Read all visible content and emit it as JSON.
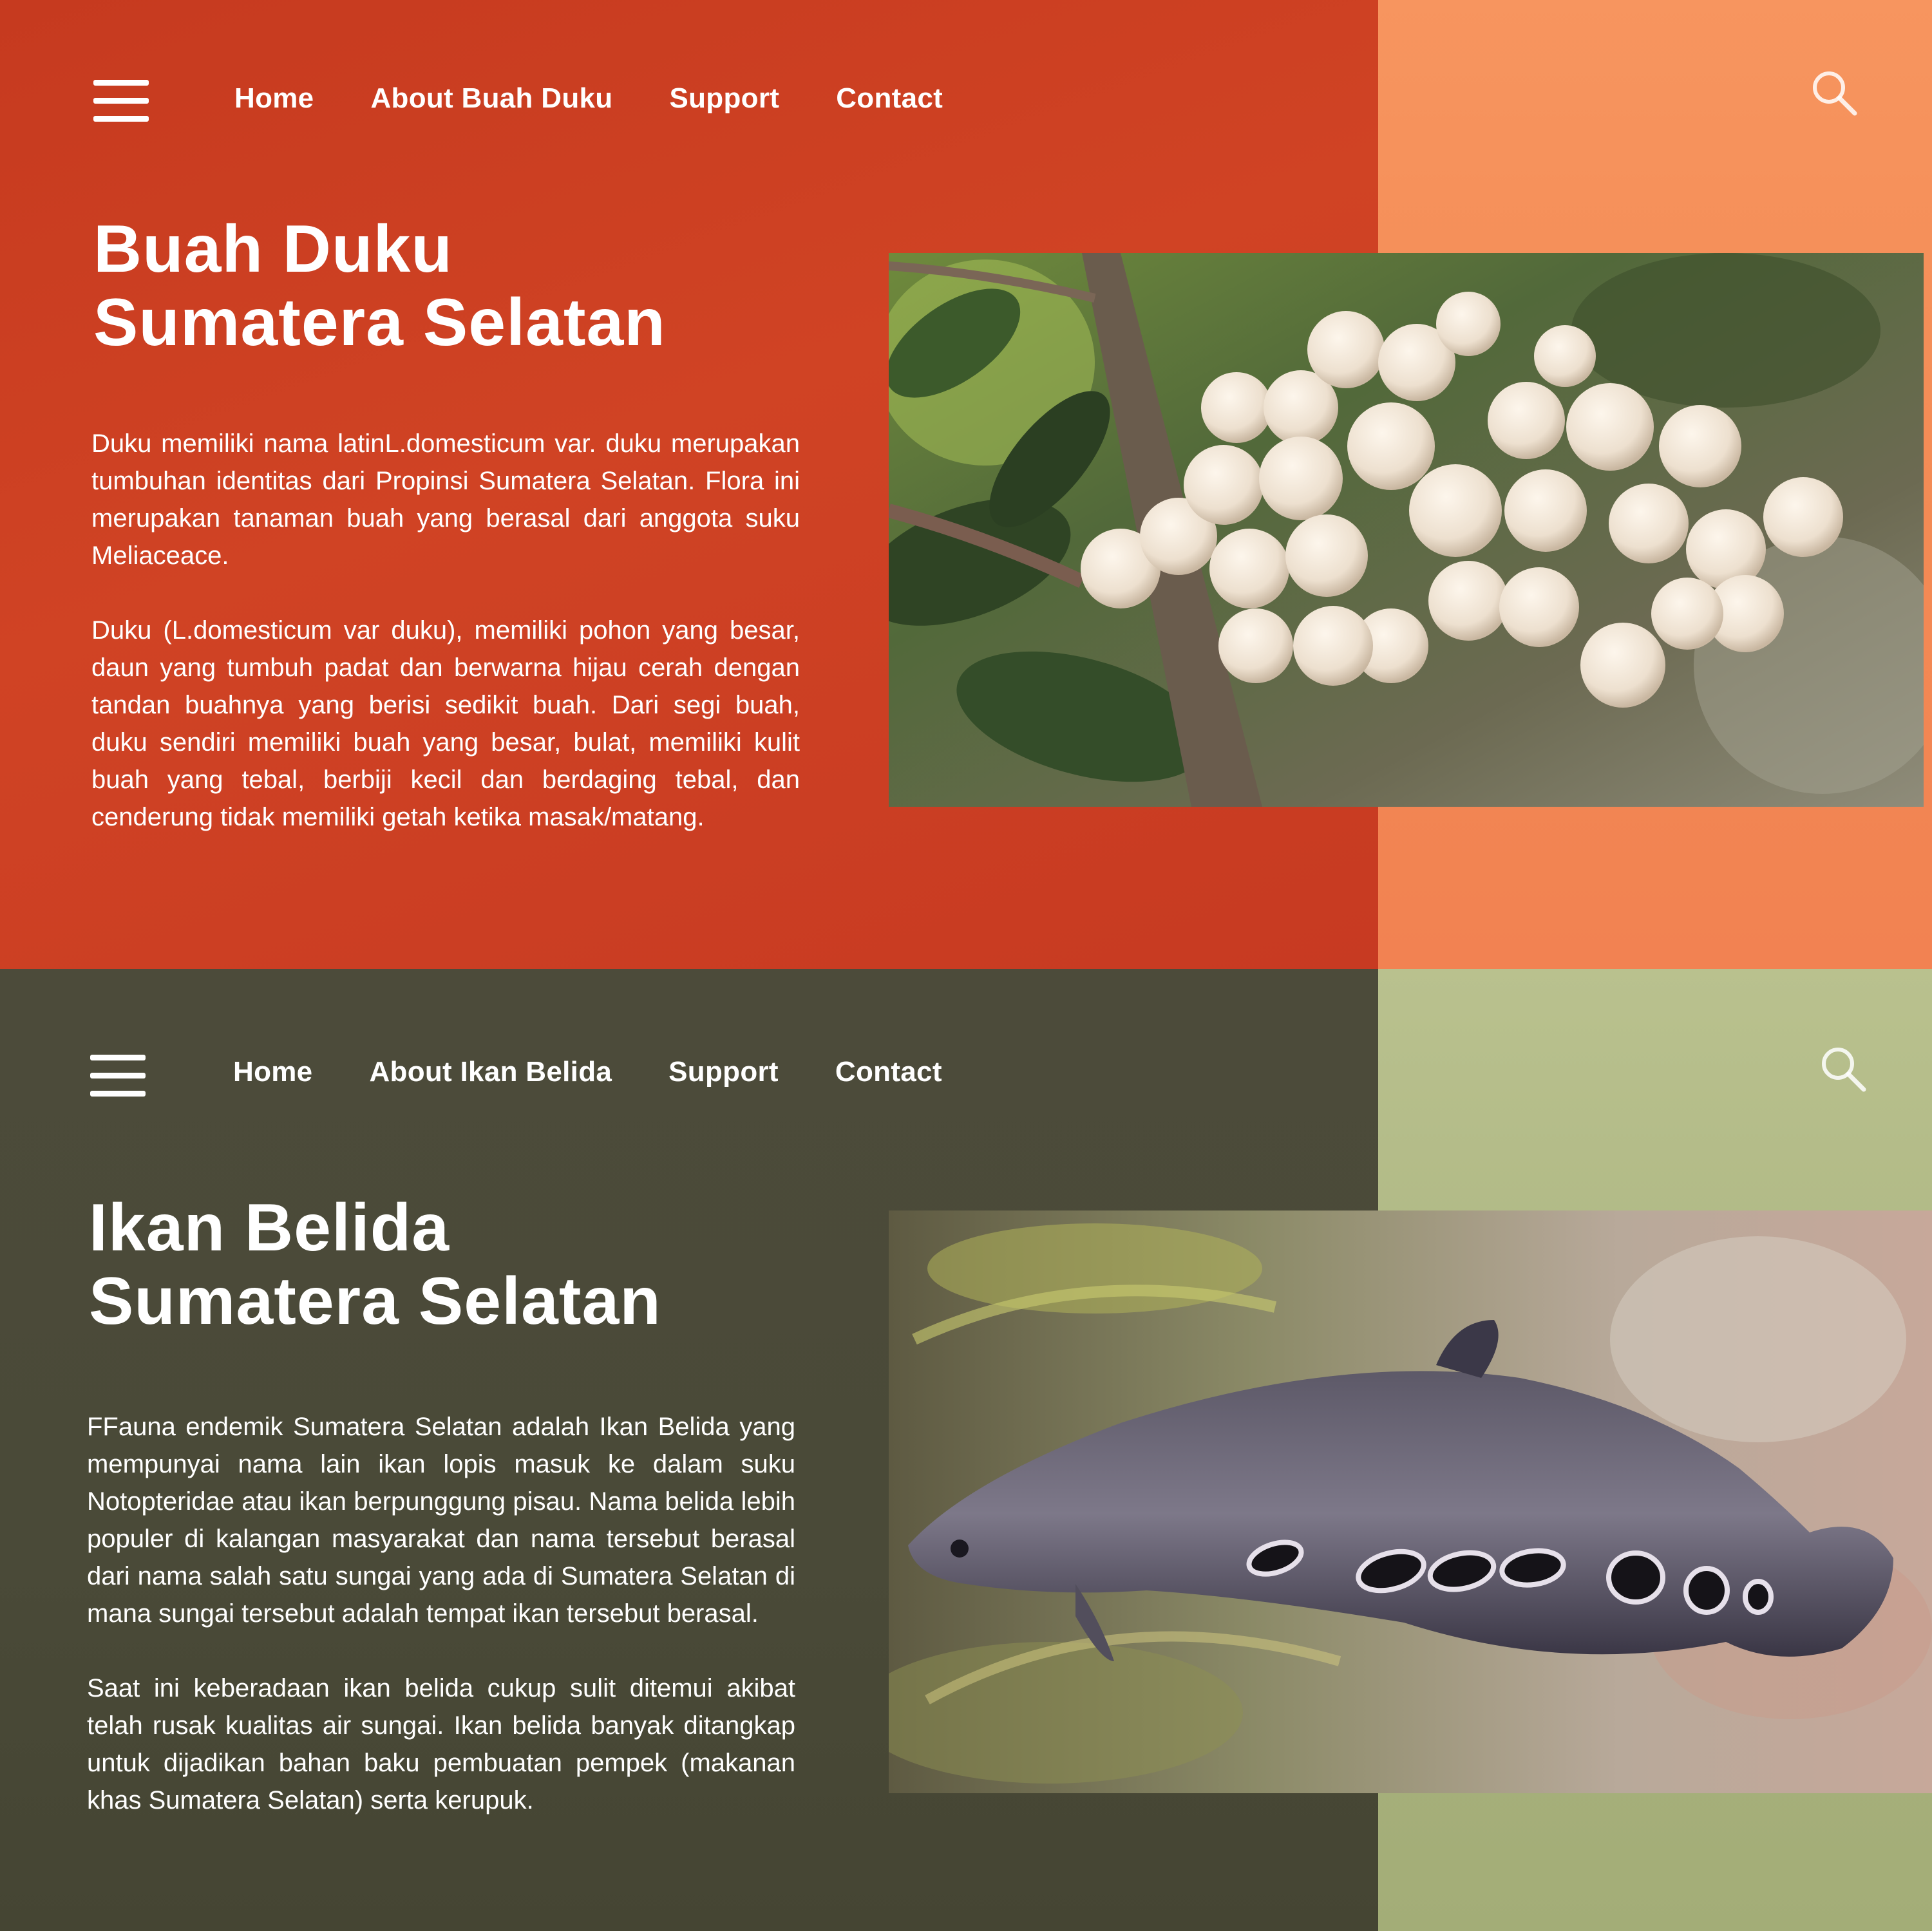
{
  "duku": {
    "nav": [
      "Home",
      "About Buah Duku",
      "Support",
      "Contact"
    ],
    "title_line1": "Buah Duku",
    "title_line2": "Sumatera Selatan",
    "paragraphs": [
      "Duku memiliki nama latinL.domesticum var. duku merupakan tumbuhan identitas dari Propinsi Sumatera Selatan. Flora ini merupakan tanaman buah yang berasal dari anggota suku Meliaceace.",
      "Duku (L.domesticum var  duku), memiliki pohon yang besar, daun yang tumbuh padat dan berwarna hijau cerah dengan tandan buahnya yang berisi sedikit buah. Dari segi buah, duku sendiri memiliki buah yang besar, bulat, memiliki kulit buah yang tebal, berbiji kecil dan berdaging tebal, dan cenderung tidak memiliki getah ketika masak/matang."
    ],
    "colors": {
      "left": "#c83c21",
      "right": "#f38a54"
    }
  },
  "belida": {
    "nav": [
      "Home",
      "About Ikan Belida",
      "Support",
      "Contact"
    ],
    "title_line1": "Ikan Belida",
    "title_line2": "Sumatera Selatan",
    "paragraphs": [
      "FFauna endemik Sumatera Selatan adalah Ikan Belida yang mempunyai nama lain ikan lopis masuk ke dalam suku Notopteridae atau ikan berpunggung pisau. Nama belida lebih populer di kalangan masyarakat dan nama tersebut berasal dari nama salah satu sungai yang ada di Sumatera Selatan di mana sungai tersebut adalah tempat ikan tersebut berasal.",
      "Saat ini keberadaan ikan belida cukup sulit ditemui akibat telah rusak kualitas air sungai. Ikan belida banyak ditangkap untuk dijadikan bahan baku pembuatan pempek (makanan khas Sumatera Selatan) serta kerupuk."
    ],
    "colors": {
      "left": "#4a4a38",
      "right": "#aab27e"
    }
  },
  "icons": {
    "menu": "hamburger-menu-icon",
    "search": "search-icon"
  }
}
